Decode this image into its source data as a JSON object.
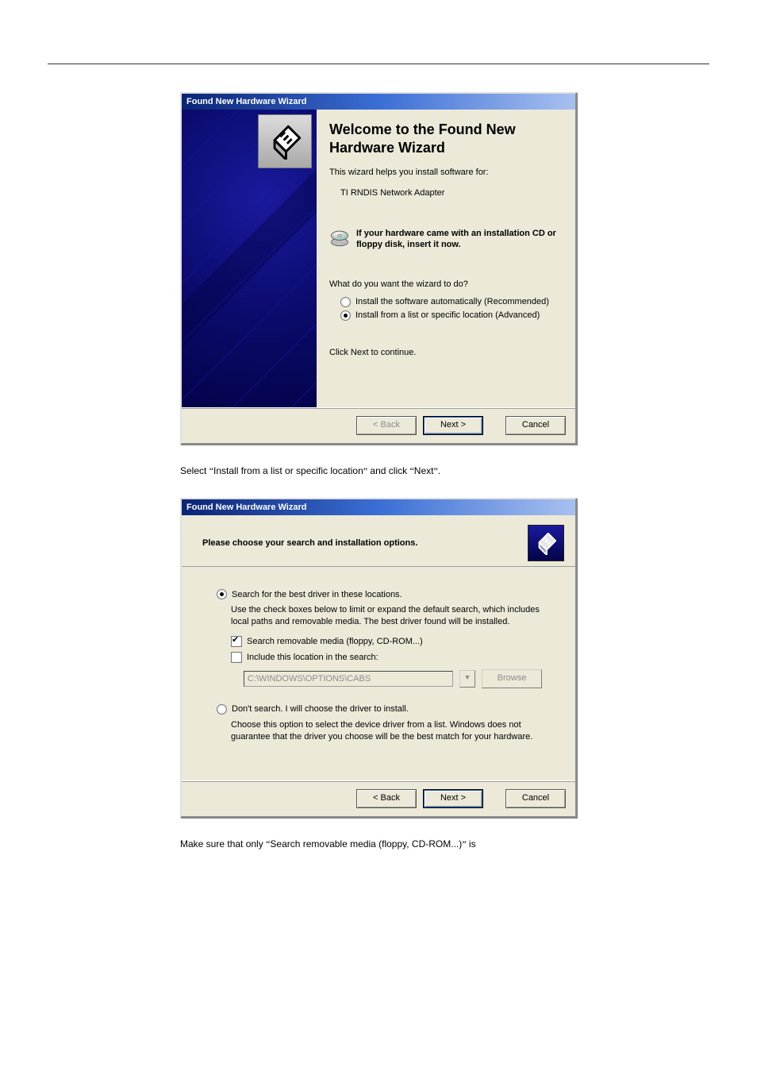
{
  "dialog1": {
    "title": "Found New Hardware Wizard",
    "heading": "Welcome to the Found New Hardware Wizard",
    "intro": "This wizard helps you install software for:",
    "device": "TI RNDIS Network Adapter",
    "cd_hint": "If your hardware came with an installation CD or floppy disk, insert it now.",
    "question": "What do you want the wizard to do?",
    "opt_auto": "Install the software automatically (Recommended)",
    "opt_advanced": "Install from a list or specific location (Advanced)",
    "selected_option": "advanced",
    "click_next": "Click Next to continue.",
    "btn_back": "< Back",
    "btn_next": "Next >",
    "btn_cancel": "Cancel"
  },
  "instr1_prefix": "Select ",
  "instr1_quoted": "Install from a list or specific location",
  "instr1_mid": " and click ",
  "instr1_next": "Next",
  "instr1_suffix": ".",
  "dialog2": {
    "title": "Found New Hardware Wizard",
    "header": "Please choose your search and installation options.",
    "opt_search": "Search for the best driver in these locations.",
    "opt_search_desc": "Use the check boxes below to limit or expand the default search, which includes local paths and removable media. The best driver found will be installed.",
    "chk_removable": "Search removable media (floppy, CD-ROM...)",
    "chk_removable_checked": true,
    "chk_include_loc": "Include this location in the search:",
    "chk_include_loc_checked": false,
    "path_value": "C:\\WINDOWS\\OPTIONS\\CABS",
    "browse": "Browse",
    "opt_dont_search": "Don't search. I will choose the driver to install.",
    "opt_dont_search_desc": "Choose this option to select the device driver from a list.  Windows does not guarantee that the driver you choose will be the best match for your hardware.",
    "selected_option": "search",
    "btn_back": "< Back",
    "btn_next": "Next >",
    "btn_cancel": "Cancel"
  },
  "instr2_prefix": "Make sure that only ",
  "instr2_quoted": "Search removable media (floppy, CD-ROM...)",
  "instr2_suffix": " is",
  "chevron": "▼"
}
